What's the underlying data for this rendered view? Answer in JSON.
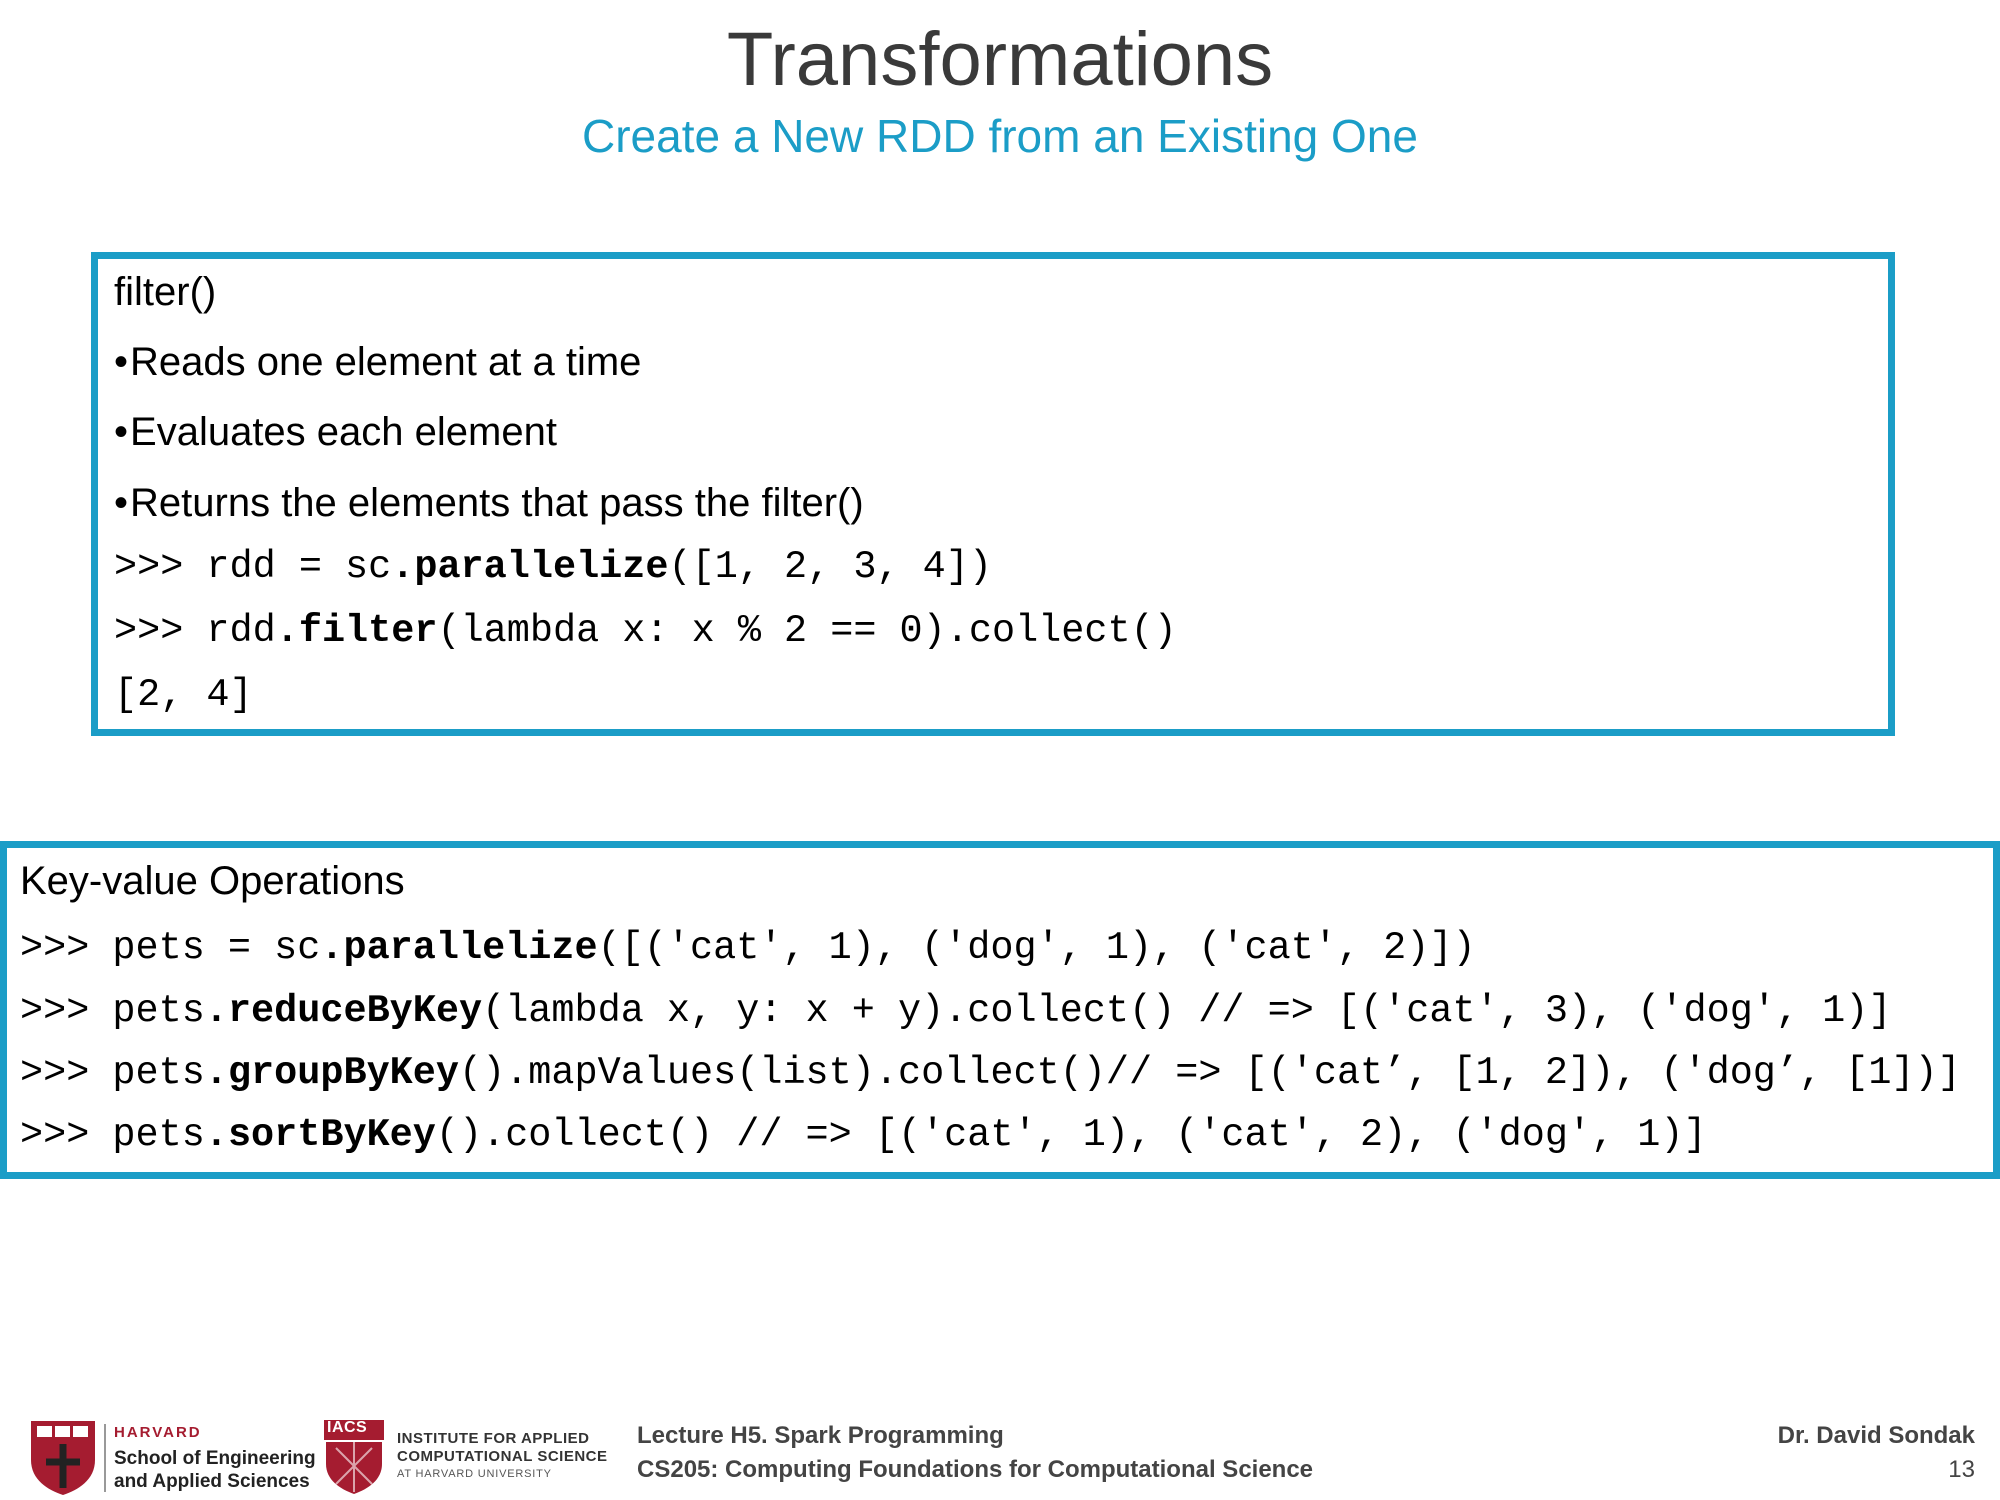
{
  "slide": {
    "title": "Transformations",
    "subtitle": "Create a New RDD from an Existing One"
  },
  "box1": {
    "heading": "filter()",
    "bullets": [
      "Reads one element at a time",
      "Evaluates each element",
      "Returns the elements that pass the filter()"
    ],
    "code": [
      {
        "pre": ">>> rdd = sc",
        "bold": ".parallelize",
        "post": "([1, 2, 3, 4])"
      },
      {
        "pre": ">>> rdd",
        "bold": ".filter",
        "post": "(lambda x: x % 2 == 0).collect()"
      },
      {
        "pre": "[2, 4]",
        "bold": "",
        "post": ""
      }
    ]
  },
  "box2": {
    "heading": "Key-value Operations",
    "code": [
      {
        "pre": ">>> pets = sc",
        "bold": ".parallelize",
        "post": "([('cat', 1), ('dog', 1), ('cat', 2)])"
      },
      {
        "pre": ">>> pets",
        "bold": ".reduceByKey",
        "post": "(lambda x, y: x + y).collect() // => [('cat', 3), ('dog', 1)]"
      },
      {
        "pre": ">>> pets",
        "bold": ".groupByKey",
        "post": "().mapValues(list).collect()// => [('cat’, [1, 2]), ('dog’, [1])]"
      },
      {
        "pre": ">>> pets",
        "bold": ".sortByKey",
        "post": "().collect() // => [('cat', 1), ('cat', 2), ('dog', 1)]"
      }
    ]
  },
  "footer": {
    "harvard_name": "HARVARD",
    "seas_line1": "School of Engineering",
    "seas_line2": "and Applied Sciences",
    "iacs_abbr": "IACS",
    "iacs_line1": "INSTITUTE FOR APPLIED",
    "iacs_line2": "COMPUTATIONAL SCIENCE",
    "iacs_line3": "AT HARVARD UNIVERSITY",
    "lecture": "Lecture H5. Spark Programming",
    "course": "CS205: Computing Foundations for Computational Science",
    "author": "Dr. David Sondak",
    "page_number": "13"
  },
  "colors": {
    "accent": "#1b9dc7",
    "title": "#3a3a3a",
    "harvard_crimson": "#a51c30"
  }
}
